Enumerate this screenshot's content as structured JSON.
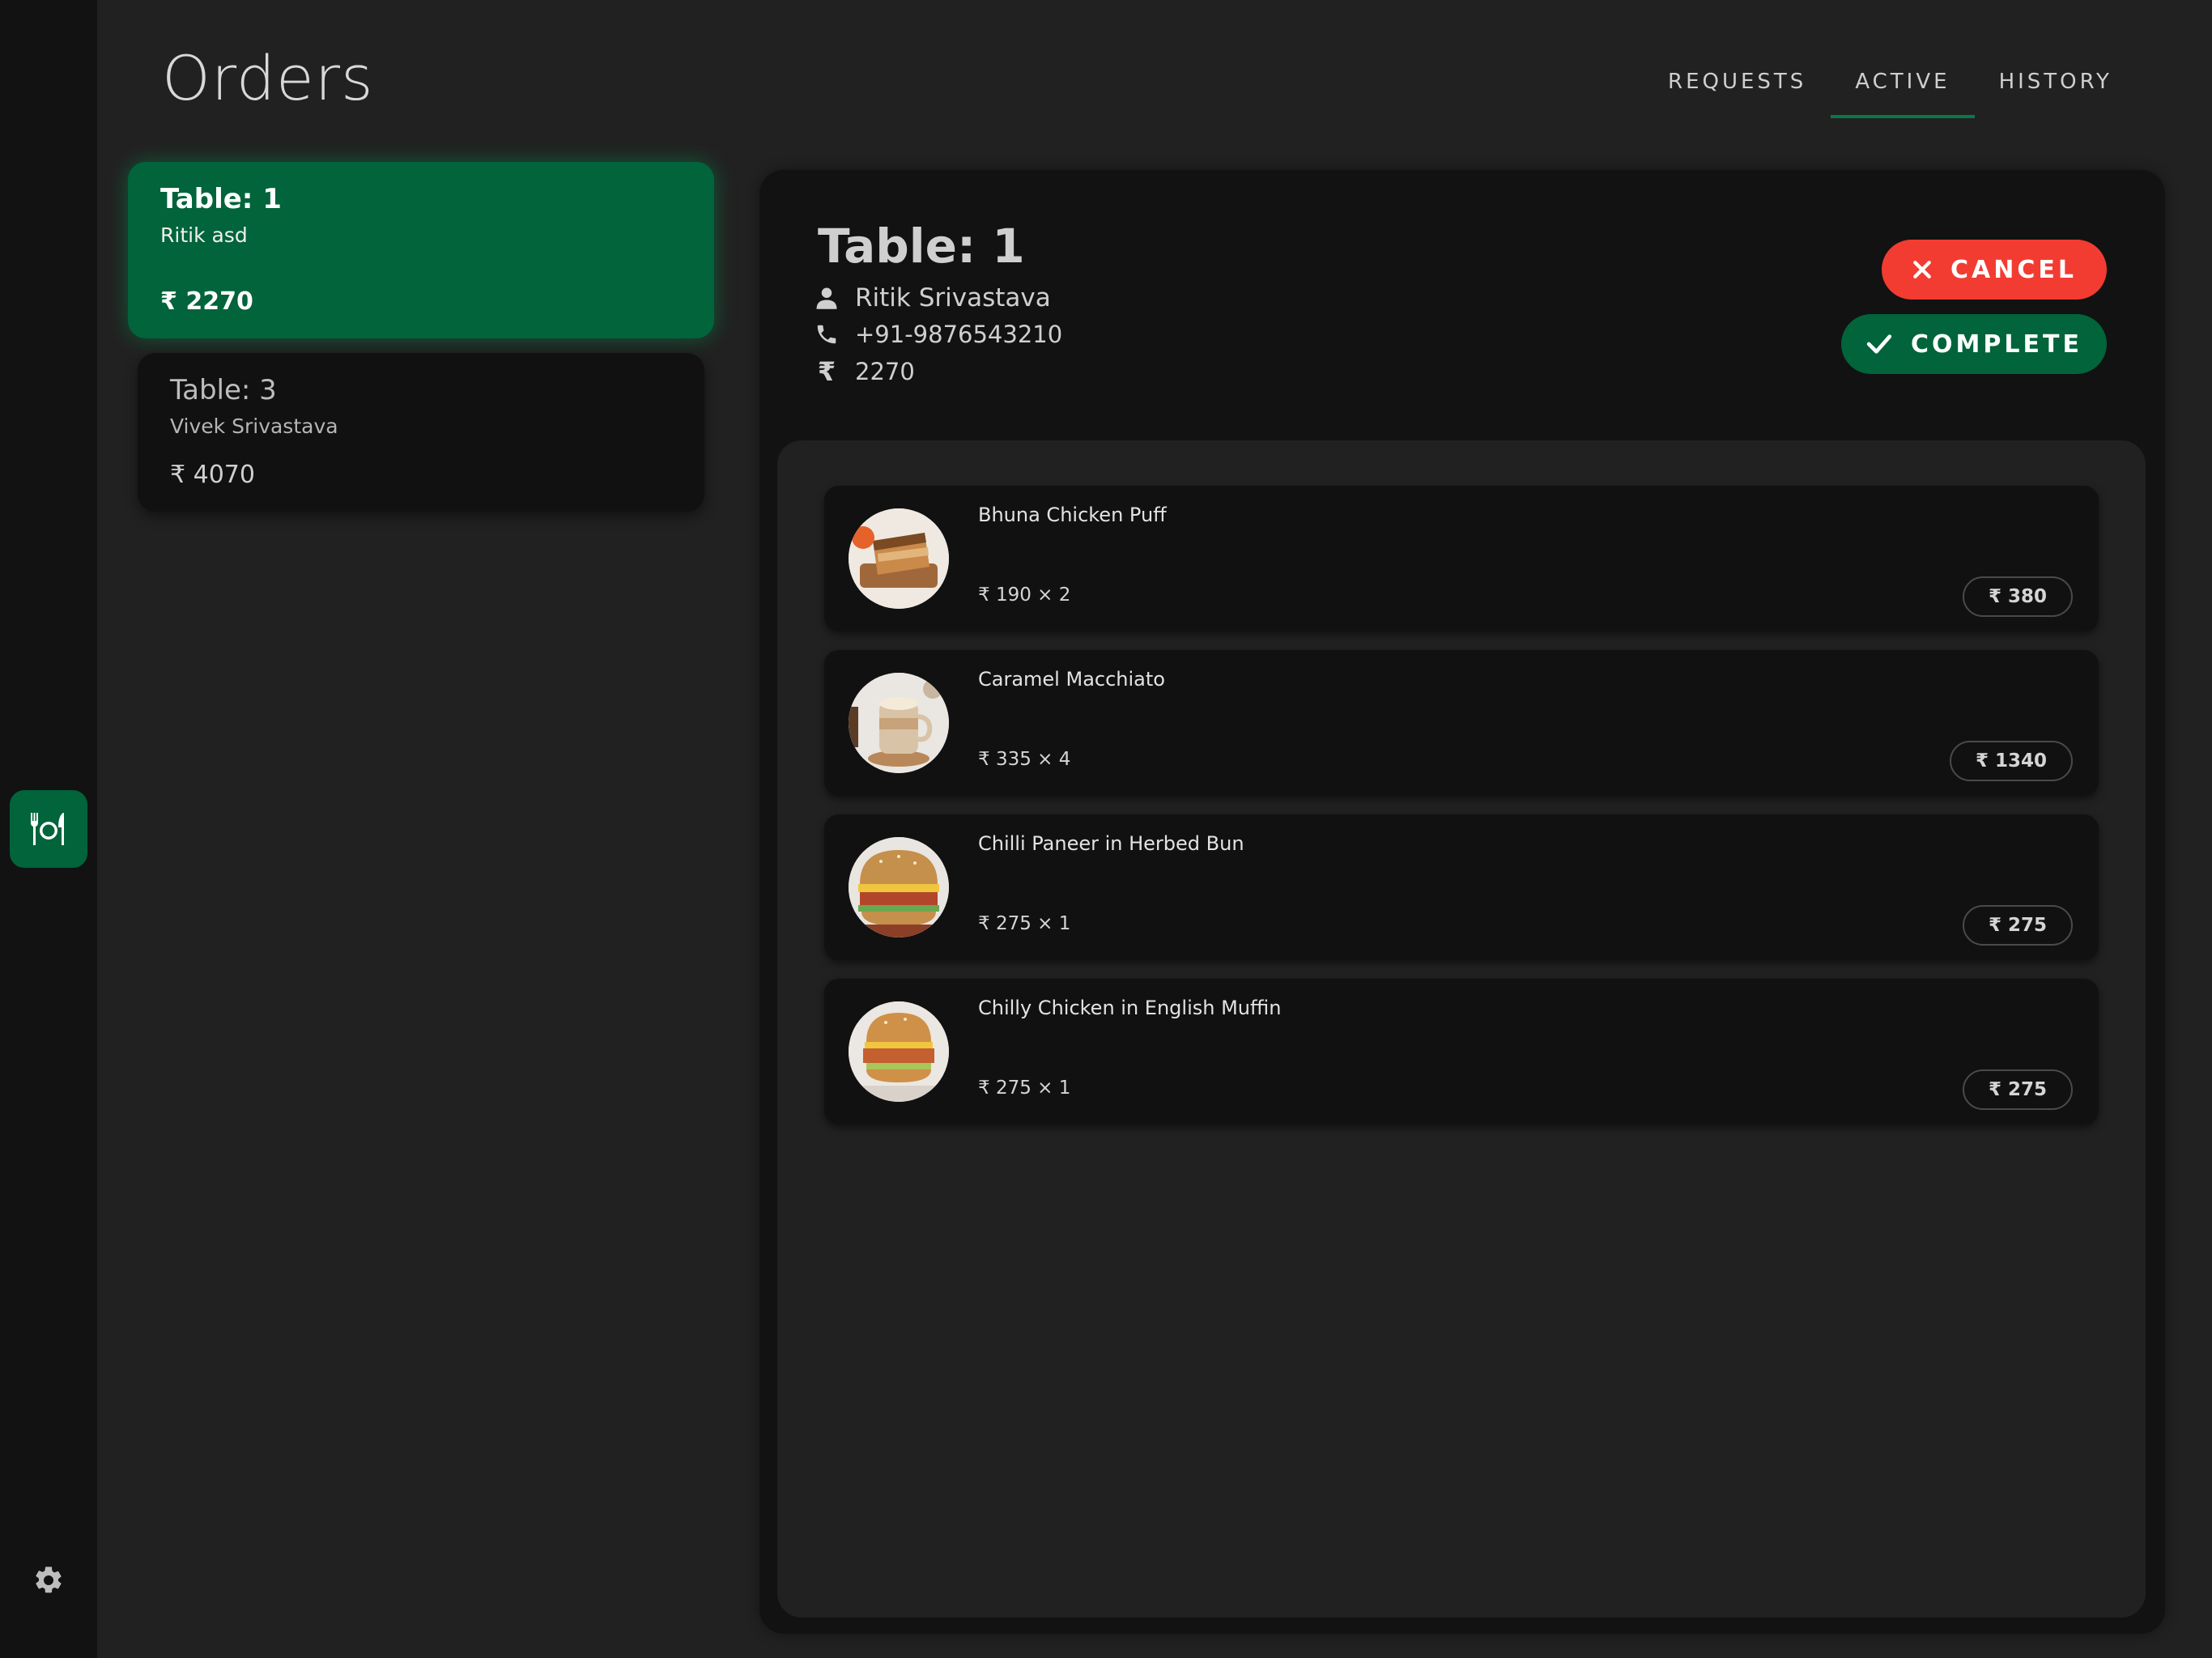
{
  "header": {
    "title": "Orders",
    "tabs": [
      {
        "label": "REQUESTS",
        "active": false
      },
      {
        "label": "ACTIVE",
        "active": true
      },
      {
        "label": "HISTORY",
        "active": false
      }
    ]
  },
  "rail": {
    "main_icon": "restaurant-icon",
    "settings_icon": "gear-icon"
  },
  "orders": [
    {
      "table": "Table: 1",
      "name": "Ritik asd",
      "total": "₹ 2270",
      "selected": true
    },
    {
      "table": "Table: 3",
      "name": "Vivek Srivastava",
      "total": "₹ 4070",
      "selected": false
    }
  ],
  "detail": {
    "table": "Table: 1",
    "customer": "Ritik Srivastava",
    "phone": "+91-9876543210",
    "amount": "2270",
    "currency_symbol": "₹",
    "cancel_label": "CANCEL",
    "complete_label": "COMPLETE",
    "items": [
      {
        "name": "Bhuna Chicken Puff",
        "qty": "₹ 190 × 2",
        "total": "₹ 380",
        "thumb": "puff"
      },
      {
        "name": "Caramel Macchiato",
        "qty": "₹ 335 × 4",
        "total": "₹ 1340",
        "thumb": "coffee"
      },
      {
        "name": "Chilli Paneer in Herbed Bun",
        "qty": "₹ 275 × 1",
        "total": "₹ 275",
        "thumb": "burger"
      },
      {
        "name": "Chilly Chicken in English Muffin",
        "qty": "₹ 275 × 1",
        "total": "₹ 275",
        "thumb": "burger"
      }
    ]
  },
  "colors": {
    "accent_green": "#01643a",
    "cancel_red": "#f23c32",
    "background": "#212121",
    "panel": "#121212"
  }
}
